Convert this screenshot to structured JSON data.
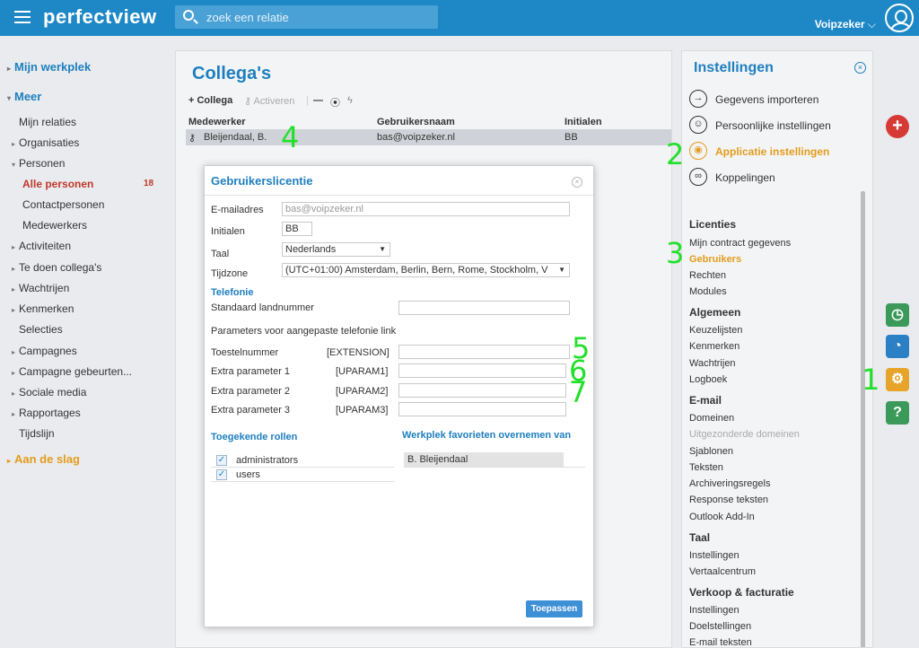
{
  "topbar": {
    "logo": "perfectview",
    "search_placeholder": "zoek een relatie",
    "user": "Voipzeker",
    "user_chevron": "⌵"
  },
  "leftnav": {
    "items": [
      {
        "label": "Mijn werkplek",
        "arrow": "▸"
      },
      {
        "label": "Meer",
        "arrow": "▾"
      },
      {
        "label": "Mijn relaties",
        "arrow": ""
      },
      {
        "label": "Organisaties",
        "arrow": "▸"
      },
      {
        "label": "Personen",
        "arrow": "▾"
      },
      {
        "label": "Alle personen",
        "arrow": "",
        "badge": "18"
      },
      {
        "label": "Contactpersonen",
        "arrow": ""
      },
      {
        "label": "Medewerkers",
        "arrow": ""
      },
      {
        "label": "Activiteiten",
        "arrow": "▸"
      },
      {
        "label": "Te doen collega's",
        "arrow": "▸"
      },
      {
        "label": "Wachtrijen",
        "arrow": "▸"
      },
      {
        "label": "Kenmerken",
        "arrow": "▸"
      },
      {
        "label": "Selecties",
        "arrow": ""
      },
      {
        "label": "Campagnes",
        "arrow": "▸"
      },
      {
        "label": "Campagne gebeurten...",
        "arrow": "▸"
      },
      {
        "label": "Sociale media",
        "arrow": "▸"
      },
      {
        "label": "Rapportages",
        "arrow": "▸"
      },
      {
        "label": "Tijdslijn",
        "arrow": ""
      },
      {
        "label": "Aan de slag",
        "arrow": "▸"
      }
    ]
  },
  "main": {
    "title": "Collega's",
    "toolbar": {
      "add": "+ Collega",
      "activate": "Activeren",
      "minus": "—",
      "fingerprint": "⦿",
      "flash": "ϟ"
    },
    "columns": [
      "Medewerker",
      "Gebruikersnaam",
      "Initialen"
    ],
    "row": {
      "name": "Bleijendaal, B.",
      "username": "bas@voipzeker.nl",
      "initials": "BB"
    }
  },
  "annotations": {
    "a1": "1",
    "a2": "2",
    "a3": "3",
    "a4": "4",
    "a5": "5",
    "a6": "6",
    "a7": "7"
  },
  "settings": {
    "title": "Instellingen",
    "close": "×",
    "items": [
      {
        "label": "Gegevens importeren",
        "icon": "→"
      },
      {
        "label": "Persoonlijke instellingen",
        "icon": "☺"
      },
      {
        "label": "Applicatie instellingen",
        "icon": "◉"
      },
      {
        "label": "Koppelingen",
        "icon": "∞"
      }
    ],
    "sections": {
      "licenties": "Licenties",
      "mijn_contract": "Mijn contract gegevens",
      "gebruikers": "Gebruikers",
      "rechten": "Rechten",
      "modules": "Modules",
      "algemeen": "Algemeen",
      "keuzelijsten": "Keuzelijsten",
      "kenmerken": "Kenmerken",
      "wachtrijen": "Wachtrijen",
      "logboek": "Logboek",
      "email": "E-mail",
      "domeinen": "Domeinen",
      "uitgezonderde": "Uitgezonderde domeinen",
      "sjablonen": "Sjablonen",
      "teksten": "Teksten",
      "archivering": "Archiveringsregels",
      "response": "Response teksten",
      "outlook": "Outlook Add-In",
      "taal": "Taal",
      "instellingen": "Instellingen",
      "vertaal": "Vertaalcentrum",
      "verkoop": "Verkoop & facturatie",
      "instellingen2": "Instellingen",
      "doel": "Doelstellingen",
      "emailteksten": "E-mail teksten"
    }
  },
  "fabs": {
    "plus": "+",
    "history": "◷",
    "speed": "◔",
    "gear": "⚙",
    "help": "?"
  },
  "dialog": {
    "title": "Gebruikerslicentie",
    "close": "×",
    "email_label": "E-mailadres",
    "email_value": "bas@voipzeker.nl",
    "initialen_label": "Initialen",
    "initialen_value": "BB",
    "taal_label": "Taal",
    "taal_value": "Nederlands",
    "tijdzone_label": "Tijdzone",
    "tijdzone_value": "(UTC+01:00) Amsterdam, Berlin, Bern, Rome, Stockholm, V",
    "telefonie": "Telefonie",
    "landnummer_label": "Standaard landnummer",
    "landnummer_value": "",
    "params_title": "Parameters voor aangepaste telefonie link",
    "params": [
      {
        "label": "Toestelnummer",
        "code": "[EXTENSION]",
        "value": ""
      },
      {
        "label": "Extra parameter 1",
        "code": "[UPARAM1]",
        "value": ""
      },
      {
        "label": "Extra parameter 2",
        "code": "[UPARAM2]",
        "value": ""
      },
      {
        "label": "Extra parameter 3",
        "code": "[UPARAM3]",
        "value": ""
      }
    ],
    "rollen_title": "Toegekende rollen",
    "rollen": [
      "administrators",
      "users"
    ],
    "checkmark": "✓",
    "favorieten_title": "Werkplek favorieten overnemen van",
    "favorieten_value": "B. Bleijendaal",
    "apply": "Toepassen"
  },
  "colors": {
    "accent": "#1e88c7",
    "orange": "#e39c1d",
    "annotation": "#22e02a",
    "red": "#d63a35"
  }
}
